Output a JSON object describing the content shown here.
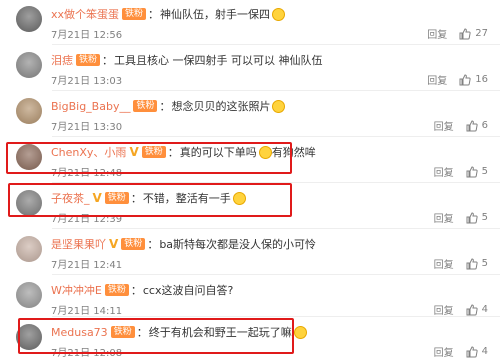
{
  "comments": [
    {
      "user": "xx做个笨蛋蛋",
      "badges": [
        "铁粉"
      ],
      "v": false,
      "text": "神仙队伍，射手一保四",
      "emoji": true,
      "time": "7月21日 12:56",
      "reply": "回复",
      "likes": "27"
    },
    {
      "user": "泪痣",
      "badges": [
        "铁粉"
      ],
      "v": false,
      "text": "工具且核心 一保四射手 可以可以 神仙队伍",
      "emoji": false,
      "time": "7月21日 13:03",
      "reply": "回复",
      "likes": "16"
    },
    {
      "user": "BigBig_Baby__",
      "badges": [
        "铁粉"
      ],
      "v": false,
      "text": "想念贝贝的这张照片",
      "emoji": true,
      "time": "7月21日 13:30",
      "reply": "回复",
      "likes": "6"
    },
    {
      "user": "ChenXy、小雨",
      "badges": [
        "铁粉"
      ],
      "v": true,
      "text": "真的可以下单吗",
      "text2": "有狗然哞",
      "emoji": true,
      "time": "7月21日 12:48",
      "reply": "回复",
      "likes": "5"
    },
    {
      "user": "子夜茶_",
      "badges": [
        "铁粉"
      ],
      "v": true,
      "text": "不错，整活有一手",
      "emoji": true,
      "time": "7月21日 12:39",
      "reply": "回复",
      "likes": "5"
    },
    {
      "user": "是坚果果吖",
      "badges": [
        "铁粉"
      ],
      "v": true,
      "text": "ba斯特每次都是没人保的小可怜",
      "emoji": false,
      "time": "7月21日 12:41",
      "reply": "回复",
      "likes": "5"
    },
    {
      "user": "W冲冲冲E",
      "badges": [
        "铁粉"
      ],
      "v": false,
      "text": "ccx这波自问自答?",
      "emoji": false,
      "time": "7月21日 14:11",
      "reply": "回复",
      "likes": "4"
    },
    {
      "user": "Medusa73",
      "badges": [
        "铁粉"
      ],
      "v": false,
      "text": "终于有机会和野王一起玩了嘛",
      "emoji": true,
      "time": "7月21日 12:08",
      "reply": "回复",
      "likes": "4"
    }
  ],
  "colors": {
    "username": "#eb7350",
    "highlight": "#e01a1a",
    "muted": "#808080"
  }
}
